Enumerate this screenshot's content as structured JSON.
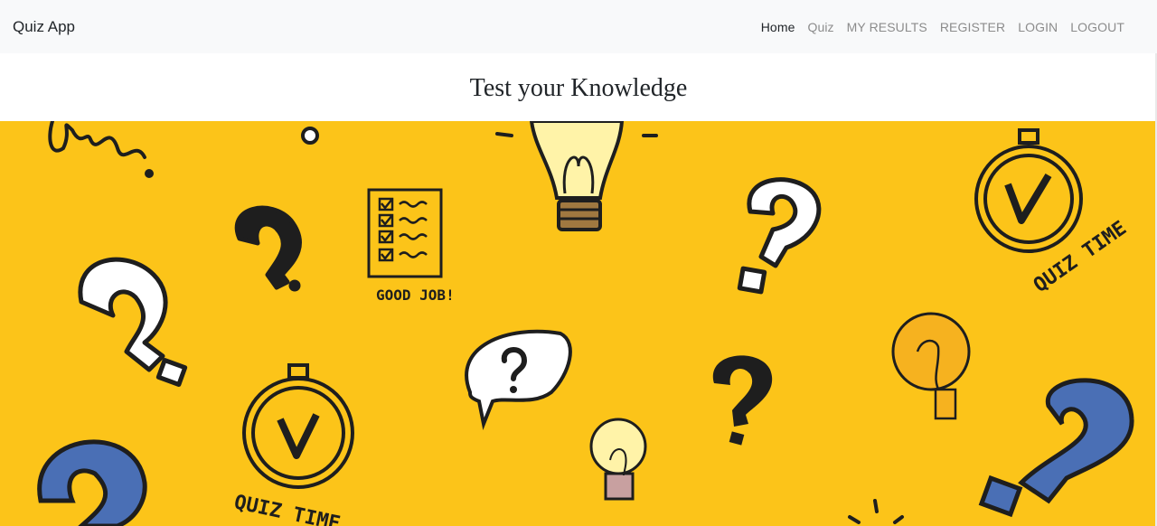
{
  "navbar": {
    "brand": "Quiz App",
    "links": [
      {
        "label": "Home",
        "active": true
      },
      {
        "label": "Quiz",
        "active": false
      },
      {
        "label": "MY RESULTS",
        "active": false
      },
      {
        "label": "REGISTER",
        "active": false
      },
      {
        "label": "LOGIN",
        "active": false
      },
      {
        "label": "LOGOUT",
        "active": false
      }
    ]
  },
  "page": {
    "title": "Test your Knowledge"
  },
  "hero": {
    "background_color": "#fcc419",
    "icons": [
      "scribble-icon",
      "question-mark-icon",
      "lightbulb-icon",
      "checklist-icon",
      "stopwatch-icon",
      "speech-bubble-icon"
    ],
    "texts": {
      "good_job": "GOOD JOB!",
      "quiz_time": "QUIZ TIME"
    }
  }
}
